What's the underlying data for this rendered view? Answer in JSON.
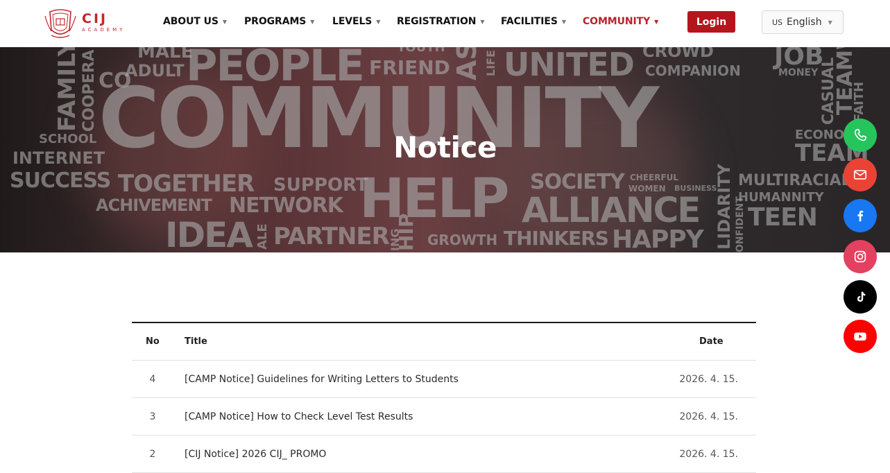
{
  "header": {
    "logo": {
      "name": "CIJ",
      "tagline": "ACADEMY"
    },
    "nav": [
      {
        "label": "ABOUT US",
        "active": false
      },
      {
        "label": "PROGRAMS",
        "active": false
      },
      {
        "label": "LEVELS",
        "active": false
      },
      {
        "label": "REGISTRATION",
        "active": false
      },
      {
        "label": "FACILITIES",
        "active": false
      },
      {
        "label": "COMMUNITY",
        "active": true
      }
    ],
    "login_label": "Login",
    "language": {
      "flag": "US",
      "selected": "English"
    }
  },
  "hero": {
    "title": "Notice",
    "background_words": [
      "COMMUNITY",
      "HELP",
      "PEOPLE",
      "UNITED",
      "TOGETHER",
      "SUCCESS",
      "INTERNET",
      "SCHOOL",
      "ALLIANCE",
      "TEEN",
      "IDEA",
      "PARTNER",
      "GROWTH",
      "THINKERS",
      "HAPPY",
      "SOCIETY",
      "SUPPORT",
      "NETWORK",
      "ACHIVEMENT",
      "FRIEND",
      "COMPANION",
      "CROWD",
      "JOB",
      "MONEY",
      "MULTIRACIAL",
      "HUMANNITY",
      "ADULT",
      "MALE",
      "FAMILY",
      "COOPERA",
      "YOUTH",
      "CHEERFUL",
      "WOMEN",
      "BUSINESS",
      "CASUAL",
      "TEAMW",
      "FAITH",
      "ECONO",
      "TEAM",
      "LIFE",
      "AS",
      "HIP",
      "ING",
      "LIDARITY",
      "ONFIDENT",
      "ALE",
      "CO"
    ]
  },
  "notice_table": {
    "columns": {
      "no": "No",
      "title": "Title",
      "date": "Date"
    },
    "rows": [
      {
        "no": "4",
        "title": "[CAMP Notice] Guidelines for Writing Letters to Students",
        "date": "2026. 4. 15."
      },
      {
        "no": "3",
        "title": "[CAMP Notice] How to Check Level Test Results",
        "date": "2026. 4. 15."
      },
      {
        "no": "2",
        "title": "[CIJ Notice] 2026 CIJ_ PROMO",
        "date": "2026. 4. 15."
      }
    ]
  },
  "social": [
    {
      "icon": "phone-icon",
      "color": "#25c55b"
    },
    {
      "icon": "mail-icon",
      "color": "#ea4335"
    },
    {
      "icon": "facebook-icon",
      "color": "#1877f2"
    },
    {
      "icon": "instagram-icon",
      "color": "#e4405f"
    },
    {
      "icon": "tiktok-icon",
      "color": "#000000"
    },
    {
      "icon": "youtube-icon",
      "color": "#ff0000"
    }
  ],
  "colors": {
    "brand": "#b5161d",
    "active_nav": "#b8232b"
  }
}
